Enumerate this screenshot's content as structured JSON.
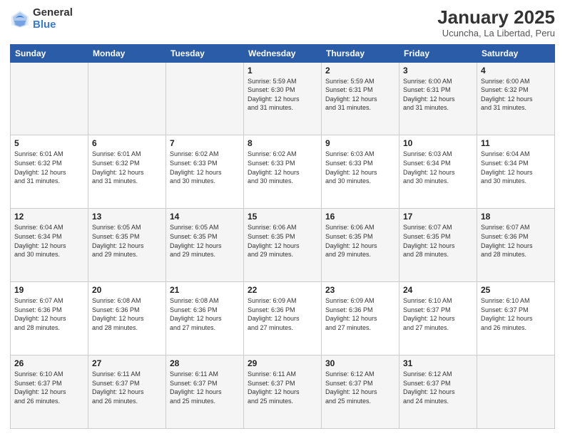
{
  "header": {
    "logo_general": "General",
    "logo_blue": "Blue",
    "month_title": "January 2025",
    "location": "Ucuncha, La Libertad, Peru"
  },
  "days_of_week": [
    "Sunday",
    "Monday",
    "Tuesday",
    "Wednesday",
    "Thursday",
    "Friday",
    "Saturday"
  ],
  "weeks": [
    [
      {
        "num": "",
        "info": ""
      },
      {
        "num": "",
        "info": ""
      },
      {
        "num": "",
        "info": ""
      },
      {
        "num": "1",
        "info": "Sunrise: 5:59 AM\nSunset: 6:30 PM\nDaylight: 12 hours\nand 31 minutes."
      },
      {
        "num": "2",
        "info": "Sunrise: 5:59 AM\nSunset: 6:31 PM\nDaylight: 12 hours\nand 31 minutes."
      },
      {
        "num": "3",
        "info": "Sunrise: 6:00 AM\nSunset: 6:31 PM\nDaylight: 12 hours\nand 31 minutes."
      },
      {
        "num": "4",
        "info": "Sunrise: 6:00 AM\nSunset: 6:32 PM\nDaylight: 12 hours\nand 31 minutes."
      }
    ],
    [
      {
        "num": "5",
        "info": "Sunrise: 6:01 AM\nSunset: 6:32 PM\nDaylight: 12 hours\nand 31 minutes."
      },
      {
        "num": "6",
        "info": "Sunrise: 6:01 AM\nSunset: 6:32 PM\nDaylight: 12 hours\nand 31 minutes."
      },
      {
        "num": "7",
        "info": "Sunrise: 6:02 AM\nSunset: 6:33 PM\nDaylight: 12 hours\nand 30 minutes."
      },
      {
        "num": "8",
        "info": "Sunrise: 6:02 AM\nSunset: 6:33 PM\nDaylight: 12 hours\nand 30 minutes."
      },
      {
        "num": "9",
        "info": "Sunrise: 6:03 AM\nSunset: 6:33 PM\nDaylight: 12 hours\nand 30 minutes."
      },
      {
        "num": "10",
        "info": "Sunrise: 6:03 AM\nSunset: 6:34 PM\nDaylight: 12 hours\nand 30 minutes."
      },
      {
        "num": "11",
        "info": "Sunrise: 6:04 AM\nSunset: 6:34 PM\nDaylight: 12 hours\nand 30 minutes."
      }
    ],
    [
      {
        "num": "12",
        "info": "Sunrise: 6:04 AM\nSunset: 6:34 PM\nDaylight: 12 hours\nand 30 minutes."
      },
      {
        "num": "13",
        "info": "Sunrise: 6:05 AM\nSunset: 6:35 PM\nDaylight: 12 hours\nand 29 minutes."
      },
      {
        "num": "14",
        "info": "Sunrise: 6:05 AM\nSunset: 6:35 PM\nDaylight: 12 hours\nand 29 minutes."
      },
      {
        "num": "15",
        "info": "Sunrise: 6:06 AM\nSunset: 6:35 PM\nDaylight: 12 hours\nand 29 minutes."
      },
      {
        "num": "16",
        "info": "Sunrise: 6:06 AM\nSunset: 6:35 PM\nDaylight: 12 hours\nand 29 minutes."
      },
      {
        "num": "17",
        "info": "Sunrise: 6:07 AM\nSunset: 6:35 PM\nDaylight: 12 hours\nand 28 minutes."
      },
      {
        "num": "18",
        "info": "Sunrise: 6:07 AM\nSunset: 6:36 PM\nDaylight: 12 hours\nand 28 minutes."
      }
    ],
    [
      {
        "num": "19",
        "info": "Sunrise: 6:07 AM\nSunset: 6:36 PM\nDaylight: 12 hours\nand 28 minutes."
      },
      {
        "num": "20",
        "info": "Sunrise: 6:08 AM\nSunset: 6:36 PM\nDaylight: 12 hours\nand 28 minutes."
      },
      {
        "num": "21",
        "info": "Sunrise: 6:08 AM\nSunset: 6:36 PM\nDaylight: 12 hours\nand 27 minutes."
      },
      {
        "num": "22",
        "info": "Sunrise: 6:09 AM\nSunset: 6:36 PM\nDaylight: 12 hours\nand 27 minutes."
      },
      {
        "num": "23",
        "info": "Sunrise: 6:09 AM\nSunset: 6:36 PM\nDaylight: 12 hours\nand 27 minutes."
      },
      {
        "num": "24",
        "info": "Sunrise: 6:10 AM\nSunset: 6:37 PM\nDaylight: 12 hours\nand 27 minutes."
      },
      {
        "num": "25",
        "info": "Sunrise: 6:10 AM\nSunset: 6:37 PM\nDaylight: 12 hours\nand 26 minutes."
      }
    ],
    [
      {
        "num": "26",
        "info": "Sunrise: 6:10 AM\nSunset: 6:37 PM\nDaylight: 12 hours\nand 26 minutes."
      },
      {
        "num": "27",
        "info": "Sunrise: 6:11 AM\nSunset: 6:37 PM\nDaylight: 12 hours\nand 26 minutes."
      },
      {
        "num": "28",
        "info": "Sunrise: 6:11 AM\nSunset: 6:37 PM\nDaylight: 12 hours\nand 25 minutes."
      },
      {
        "num": "29",
        "info": "Sunrise: 6:11 AM\nSunset: 6:37 PM\nDaylight: 12 hours\nand 25 minutes."
      },
      {
        "num": "30",
        "info": "Sunrise: 6:12 AM\nSunset: 6:37 PM\nDaylight: 12 hours\nand 25 minutes."
      },
      {
        "num": "31",
        "info": "Sunrise: 6:12 AM\nSunset: 6:37 PM\nDaylight: 12 hours\nand 24 minutes."
      },
      {
        "num": "",
        "info": ""
      }
    ]
  ]
}
